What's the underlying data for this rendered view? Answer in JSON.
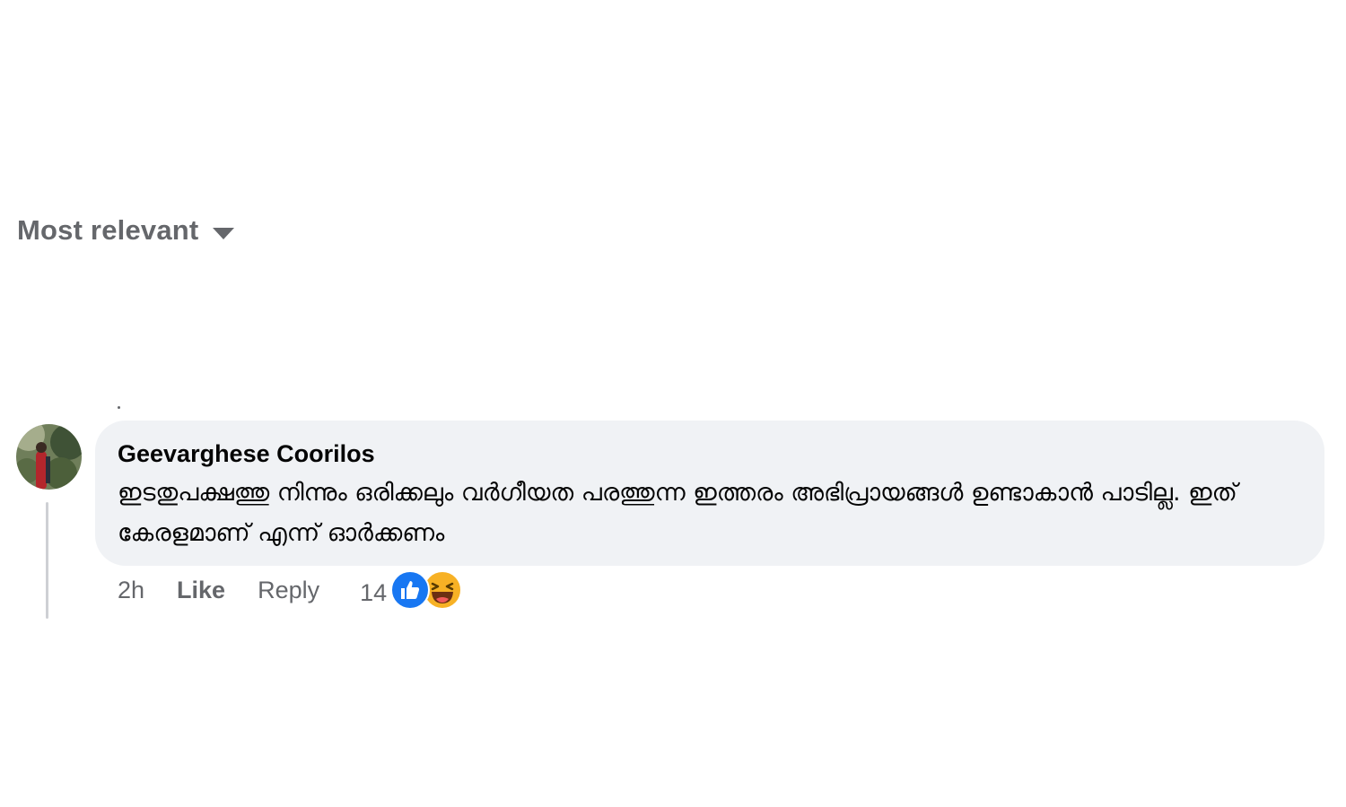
{
  "sort": {
    "label": "Most relevant",
    "icon": "caret-down-icon"
  },
  "comment": {
    "author": "Geevarghese Coorilos",
    "text": "ഇടതുപക്ഷത്തു നിന്നും ഒരിക്കലും വർഗീയത പരത്തുന്ന ഇത്തരം അഭിപ്രായങ്ങൾ ഉണ്ടാകാൻ പാടില്ല. ഇത് കേരളമാണ് എന്ന് ഓർക്കണം",
    "time": "2h",
    "like_label": "Like",
    "reply_label": "Reply",
    "reaction_count": "14",
    "reactions": [
      "like-reaction-icon",
      "haha-reaction-icon"
    ]
  },
  "colors": {
    "bubble": "#f0f2f5",
    "secondary_text": "#65676b",
    "like_blue": "#1877f2",
    "haha_yellow": "#f7b125"
  }
}
